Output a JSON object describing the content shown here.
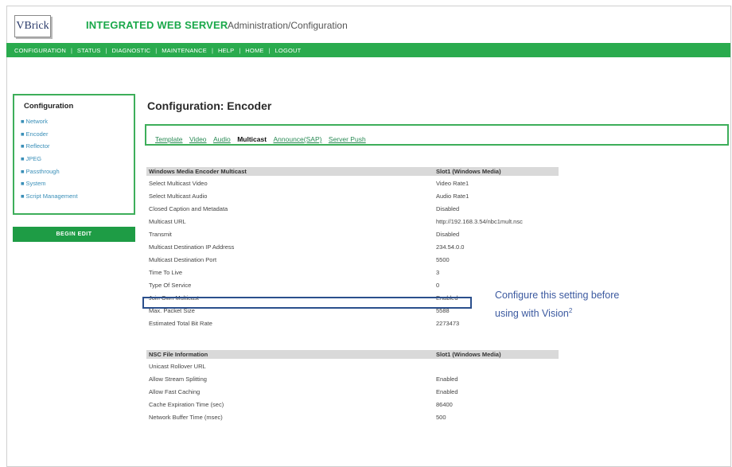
{
  "header": {
    "logo": "VBrick",
    "title": "INTEGRATED WEB SERVER",
    "subtitle": "Administration/Configuration"
  },
  "nav": [
    "CONFIGURATION",
    "STATUS",
    "DIAGNOSTIC",
    "MAINTENANCE",
    "HELP",
    "HOME",
    "LOGOUT"
  ],
  "sidebar": {
    "title": "Configuration",
    "items": [
      "Network",
      "Encoder",
      "Reflector",
      "JPEG",
      "Passthrough",
      "System",
      "Script Management"
    ],
    "begin_edit": "BEGIN EDIT"
  },
  "main": {
    "page_title": "Configuration: Encoder",
    "tabs": [
      "Template",
      "Video",
      "Audio",
      "Multicast",
      "Announce(SAP)",
      "Server Push"
    ],
    "active_tab": "Multicast"
  },
  "multicast_section": {
    "header": "Windows Media Encoder Multicast",
    "header_value": "Slot1 (Windows Media)",
    "rows": [
      {
        "label": "Select Multicast Video",
        "value": "Video Rate1"
      },
      {
        "label": "Select Multicast Audio",
        "value": "Audio Rate1"
      },
      {
        "label": "Closed Caption and Metadata",
        "value": "Disabled"
      },
      {
        "label": "Multicast URL",
        "value": "http://192.168.3.54/nbc1mult.nsc"
      },
      {
        "label": "Transmit",
        "value": "Disabled"
      },
      {
        "label": "Multicast Destination IP Address",
        "value": "234.54.0.0"
      },
      {
        "label": "Multicast Destination Port",
        "value": "5500"
      },
      {
        "label": "Time To Live",
        "value": "3"
      },
      {
        "label": "Type Of Service",
        "value": "0"
      },
      {
        "label": "Join Own Multicast",
        "value": "Enabled"
      },
      {
        "label": "Max. Packet Size",
        "value": "5588"
      },
      {
        "label": "Estimated Total Bit Rate",
        "value": "2273473"
      }
    ]
  },
  "nsc_section": {
    "header": "NSC File Information",
    "header_value": "Slot1 (Windows Media)",
    "rows": [
      {
        "label": "Unicast Rollover URL",
        "value": ""
      },
      {
        "label": "Allow Stream Splitting",
        "value": "Enabled"
      },
      {
        "label": "Allow Fast Caching",
        "value": "Enabled"
      },
      {
        "label": "Cache Expiration Time (sec)",
        "value": "86400"
      },
      {
        "label": "Network Buffer Time (msec)",
        "value": "500"
      }
    ]
  },
  "callout": {
    "line1": "Configure this setting before",
    "line2": "using with Vision",
    "superscript": "2"
  },
  "colors": {
    "accent_green": "#2aab4e",
    "link_blue": "#3a8fb8",
    "callout_blue": "#3c5aa0",
    "highlight_border": "#2b4f8c"
  }
}
